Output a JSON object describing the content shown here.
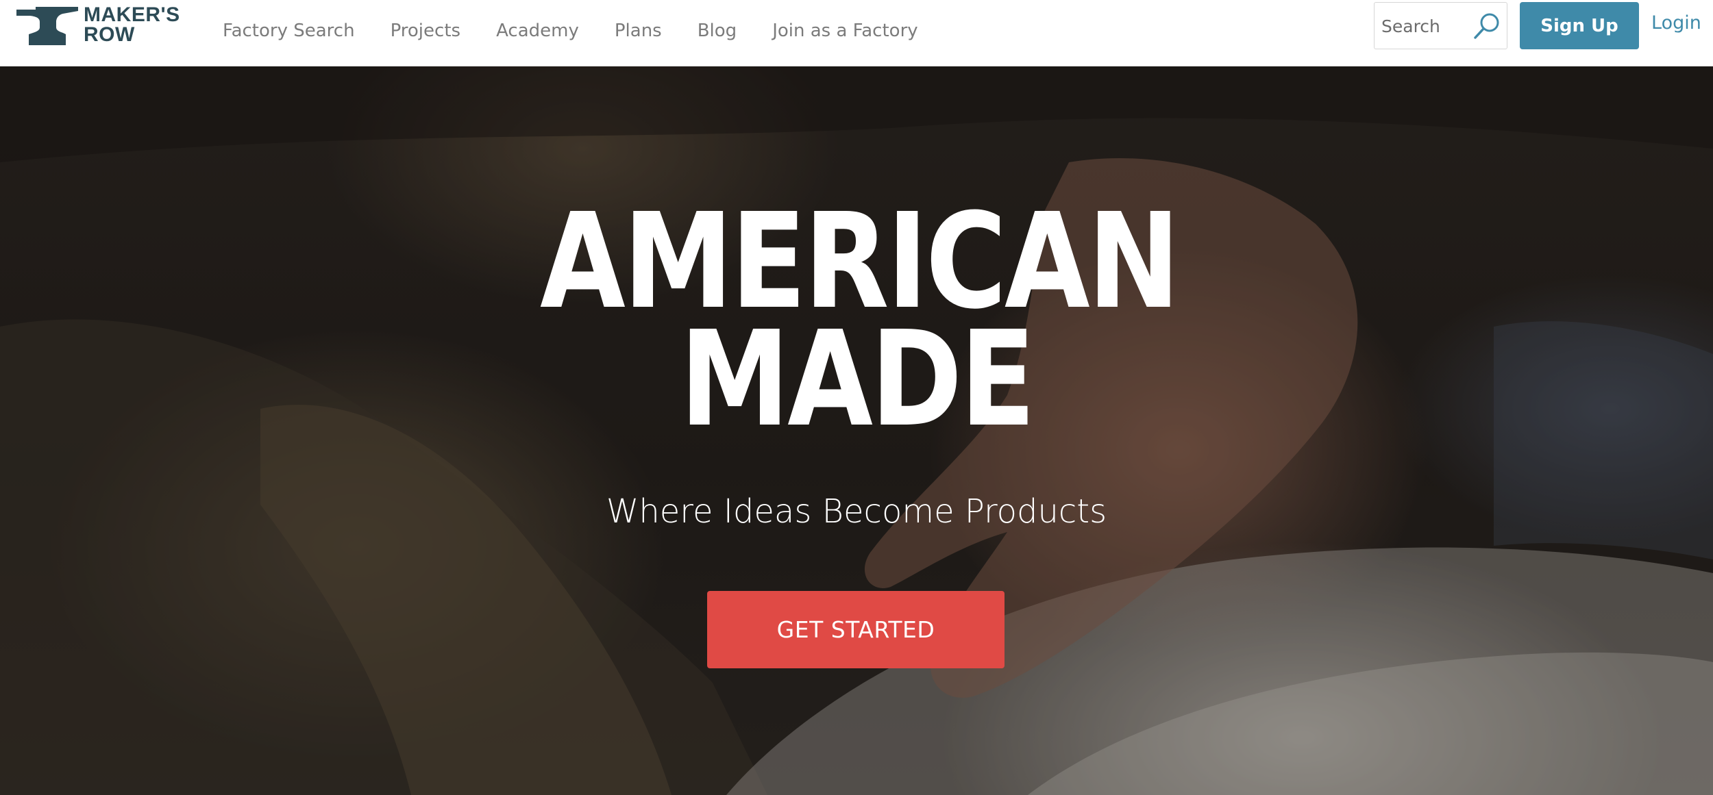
{
  "brand": {
    "name_line1": "MAKER'S",
    "name_line2": "ROW",
    "logo_icon": "anvil-icon",
    "color": "#2d4b56"
  },
  "nav": {
    "items": [
      {
        "label": "Factory Search"
      },
      {
        "label": "Projects"
      },
      {
        "label": "Academy"
      },
      {
        "label": "Plans"
      },
      {
        "label": "Blog"
      },
      {
        "label": "Join as a Factory"
      }
    ]
  },
  "search": {
    "placeholder": "Search",
    "icon": "search-icon"
  },
  "auth": {
    "signup_label": "Sign Up",
    "login_label": "Login",
    "accent_color": "#3f8aa9"
  },
  "hero": {
    "title_line1": "AMERICAN",
    "title_line2": "MADE",
    "subtitle": "Where Ideas Become Products",
    "cta_label": "GET STARTED",
    "cta_color": "#e04a45"
  }
}
